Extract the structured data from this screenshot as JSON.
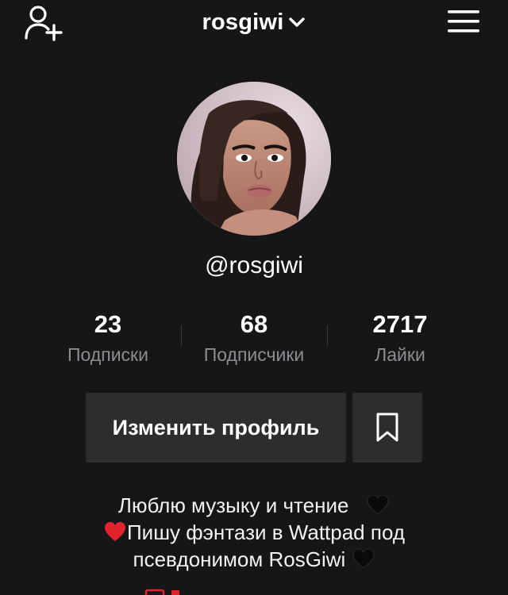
{
  "header": {
    "username": "rosgiwi"
  },
  "profile": {
    "handle": "@rosgiwi"
  },
  "stats": [
    {
      "value": "23",
      "label": "Подписки"
    },
    {
      "value": "68",
      "label": "Подписчики"
    },
    {
      "value": "2717",
      "label": "Лайки"
    }
  ],
  "actions": {
    "edit_profile": "Изменить профиль"
  },
  "bio": {
    "line1": "Люблю музыку и чтение",
    "line2": "Пишу фэнтази в Wattpad под",
    "line3": "псевдонимом RosGiwi"
  },
  "icons": {
    "add_user": "add-user-icon",
    "dropdown": "chevron-down-icon",
    "menu": "hamburger-menu-icon",
    "bookmark": "bookmark-icon",
    "black_heart": "black-heart-emoji",
    "red_heart": "red-heart-emoji"
  },
  "colors": {
    "background": "#161618",
    "button": "#2d2d30",
    "muted_text": "#8d8d91",
    "red_heart": "#e0242e"
  }
}
